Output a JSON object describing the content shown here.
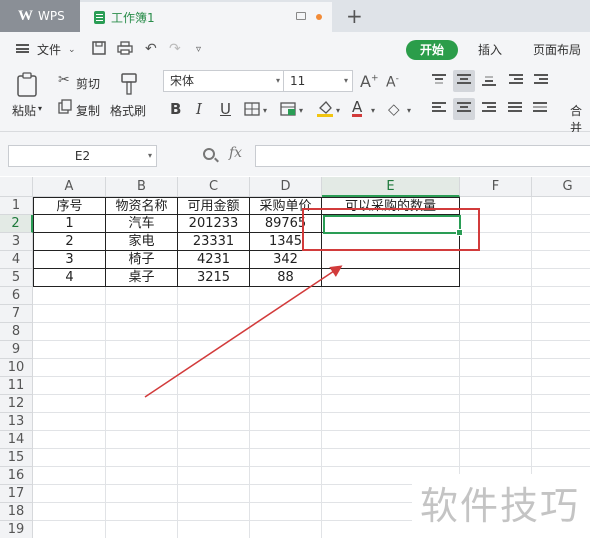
{
  "tabs": {
    "app": "WPS",
    "document": "工作簿1"
  },
  "menu": {
    "file": "文件",
    "start": "开始",
    "insert": "插入",
    "page_layout": "页面布局"
  },
  "ribbon": {
    "paste": "粘贴",
    "cut": "剪切",
    "copy": "复制",
    "format_painter": "格式刷",
    "font_name": "宋体",
    "font_size": "11",
    "merge_center": "合并"
  },
  "formula_bar": {
    "name_box": "E2",
    "fx": "fx",
    "formula": ""
  },
  "columns": [
    "A",
    "B",
    "C",
    "D",
    "E",
    "F",
    "G"
  ],
  "rows": [
    "1",
    "2",
    "3",
    "4",
    "5",
    "6",
    "7",
    "8",
    "9",
    "10",
    "11",
    "12",
    "13",
    "14",
    "15",
    "16",
    "17",
    "18",
    "19"
  ],
  "table": {
    "headers": [
      "序号",
      "物资名称",
      "可用金额",
      "采购单价",
      "可以采购的数量"
    ],
    "rows": [
      [
        "1",
        "汽车",
        "201233",
        "89765",
        ""
      ],
      [
        "2",
        "家电",
        "23331",
        "1345",
        ""
      ],
      [
        "3",
        "椅子",
        "4231",
        "342",
        ""
      ],
      [
        "4",
        "桌子",
        "3215",
        "88",
        ""
      ]
    ]
  },
  "selection": {
    "cell": "E2",
    "column": "E",
    "row": "2"
  },
  "watermark": "软件技巧",
  "colors": {
    "accent_green": "#2a9d55",
    "annotation_red": "#d23b3b"
  }
}
